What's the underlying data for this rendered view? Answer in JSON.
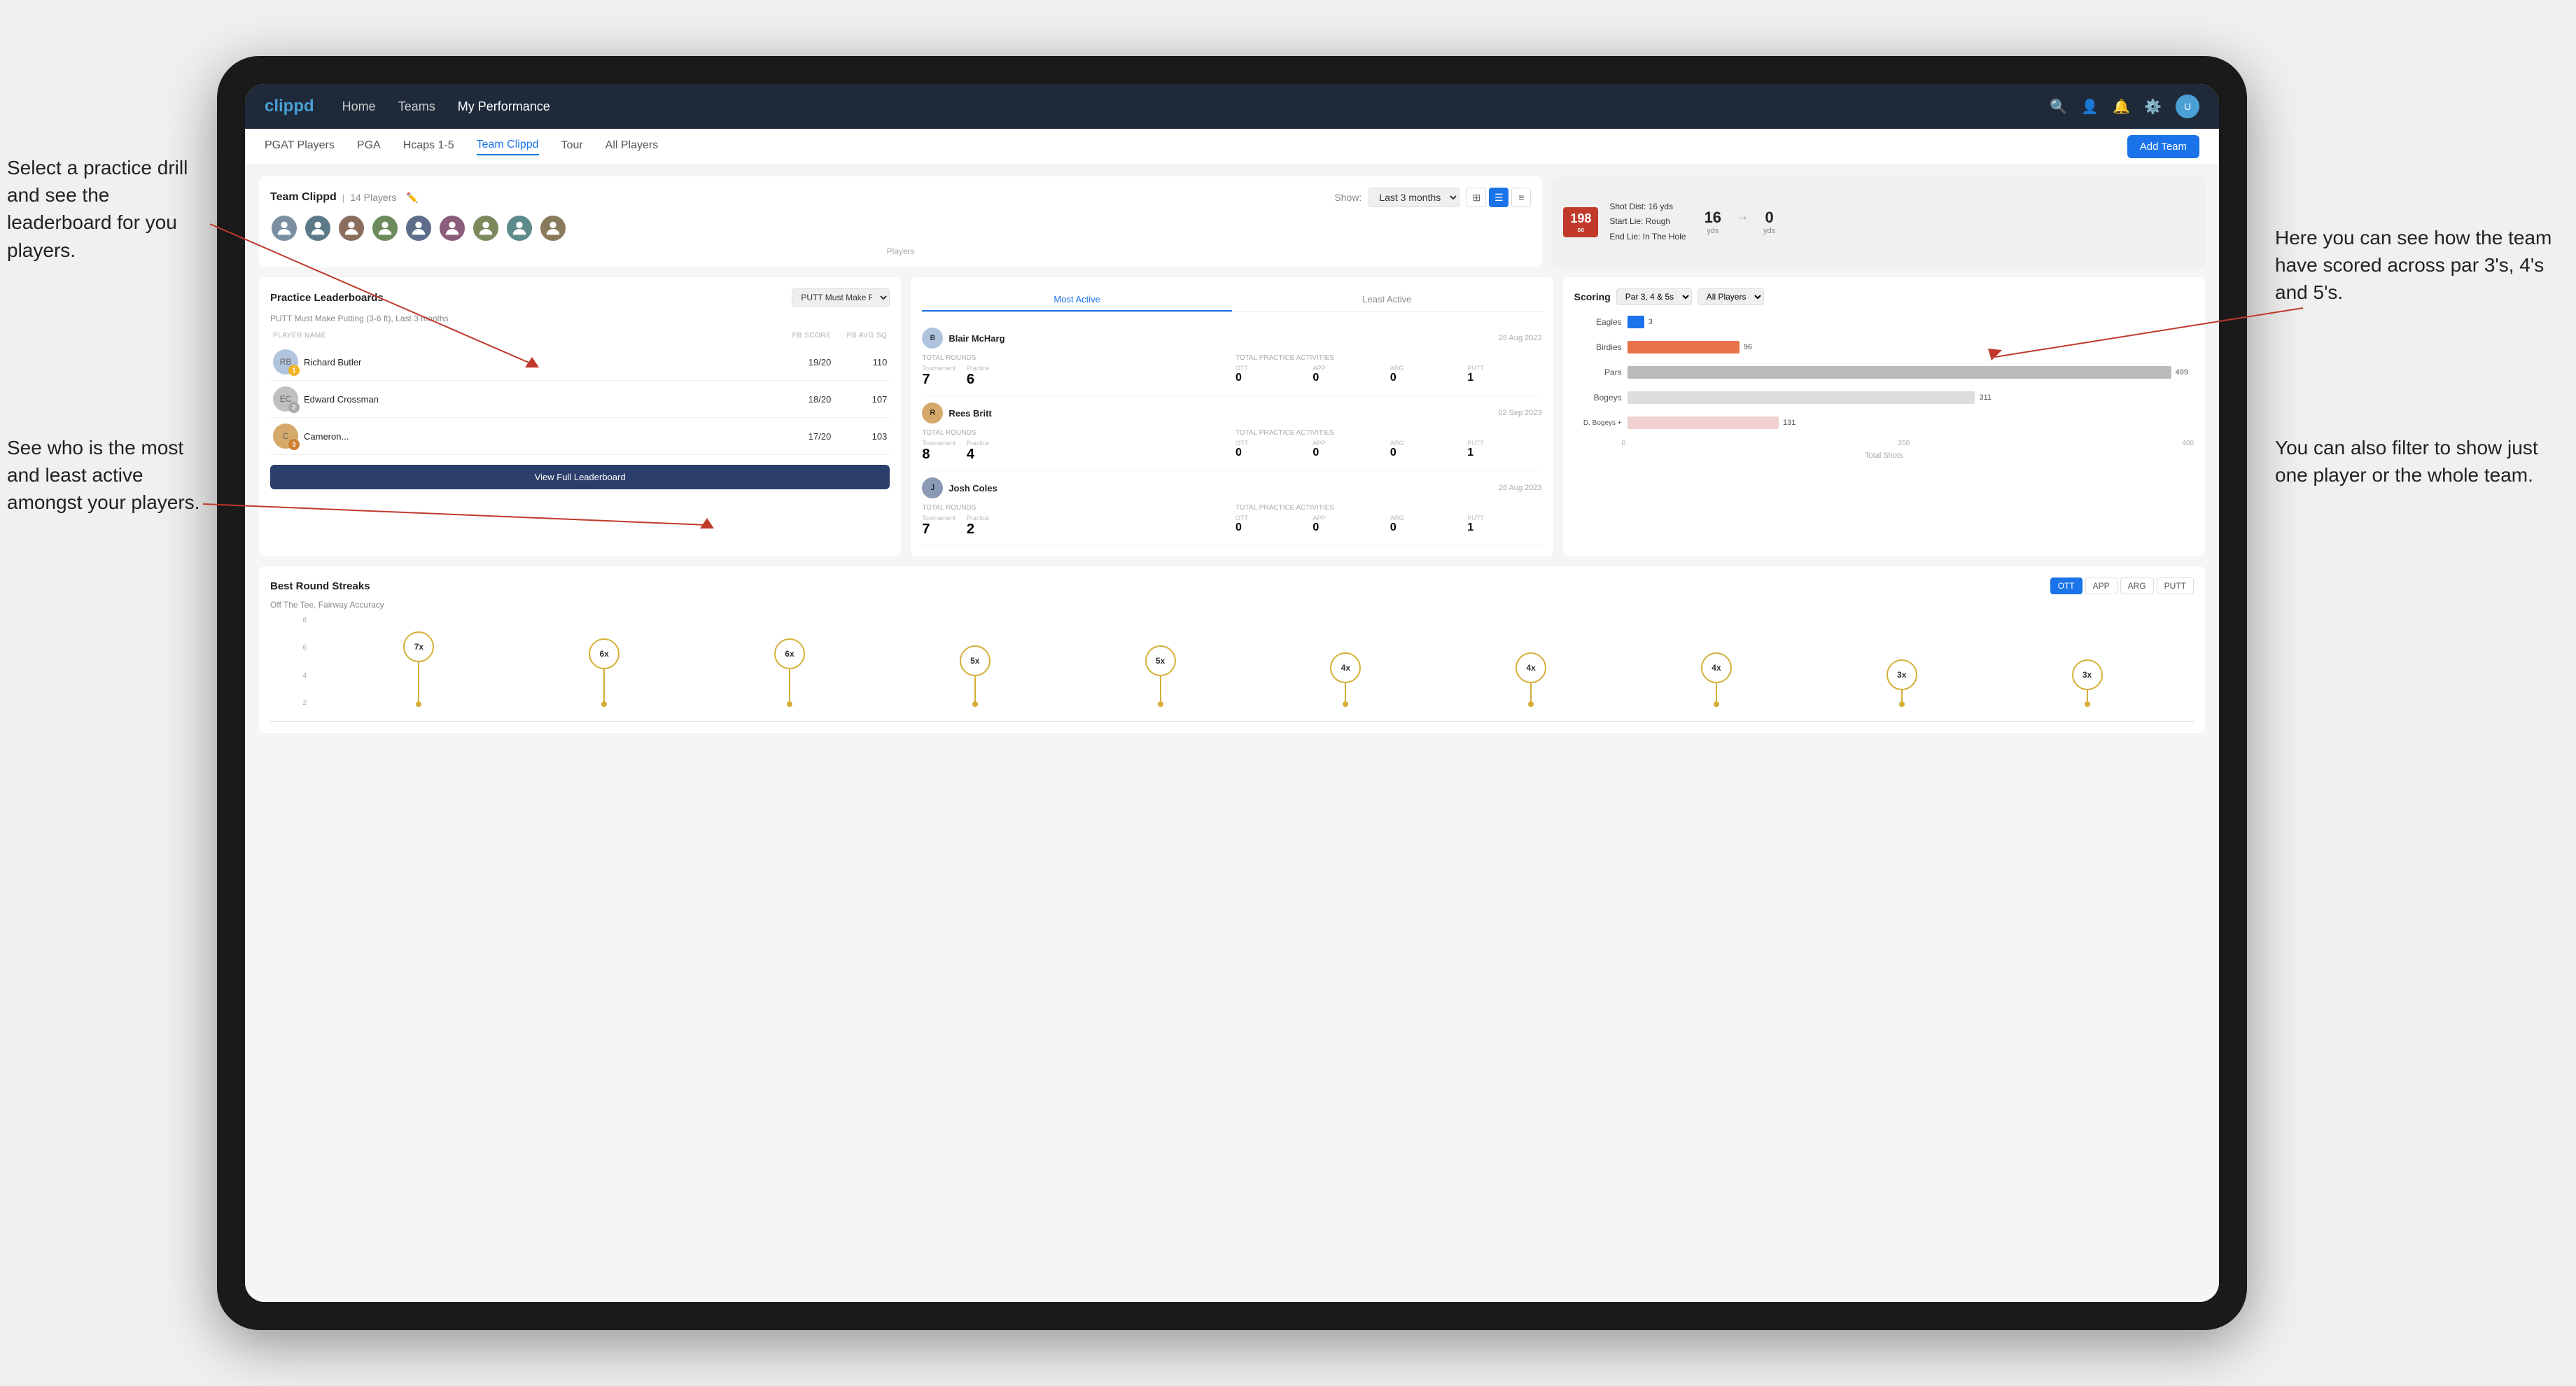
{
  "annotations": {
    "left1": "Select a practice drill and see the leaderboard for you players.",
    "left2": "See who is the most and least active amongst your players.",
    "right1": "Here you can see how the team have scored across par 3's, 4's and 5's.",
    "right2": "You can also filter to show just one player or the whole team."
  },
  "navbar": {
    "brand": "clippd",
    "links": [
      "Home",
      "Teams",
      "My Performance"
    ],
    "icons": [
      "🔍",
      "👤",
      "🔔",
      "⚙️"
    ]
  },
  "sub_navbar": {
    "links": [
      "PGAT Players",
      "PGA",
      "Hcaps 1-5",
      "Team Clippd",
      "Tour",
      "All Players"
    ],
    "active": "Team Clippd",
    "add_team": "Add Team"
  },
  "team_header": {
    "title": "Team Clippd",
    "count": "14 Players",
    "show_label": "Show:",
    "show_option": "Last 3 months",
    "shot_num": "198",
    "shot_dist": "Shot Dist: 16 yds",
    "start_lie": "Start Lie: Rough",
    "end_lie": "End Lie: In The Hole",
    "yards1": "16",
    "yards1_unit": "yds",
    "yards2": "0",
    "yards2_unit": "yds"
  },
  "practice_leaderboards": {
    "title": "Practice Leaderboards",
    "dropdown": "PUTT Must Make Putting...",
    "subtitle": "PUTT Must Make Putting (3-6 ft), Last 3 months",
    "headers": [
      "PLAYER NAME",
      "PB SCORE",
      "PB AVG SQ"
    ],
    "players": [
      {
        "name": "Richard Butler",
        "score": "19/20",
        "avg": "110",
        "medal": "gold",
        "rank": 1
      },
      {
        "name": "Edward Crossman",
        "score": "18/20",
        "avg": "107",
        "medal": "silver",
        "rank": 2
      },
      {
        "name": "Cameron...",
        "score": "17/20",
        "avg": "103",
        "medal": "bronze",
        "rank": 3
      }
    ],
    "view_full": "View Full Leaderboard"
  },
  "activity": {
    "tabs": [
      "Most Active",
      "Least Active"
    ],
    "active_tab": "Most Active",
    "players": [
      {
        "name": "Blair McHarg",
        "date": "26 Aug 2023",
        "total_rounds_label": "Total Rounds",
        "tournament": "7",
        "practice": "6",
        "total_practice_label": "Total Practice Activities",
        "ott": "0",
        "app": "0",
        "arg": "0",
        "putt": "1"
      },
      {
        "name": "Rees Britt",
        "date": "02 Sep 2023",
        "total_rounds_label": "Total Rounds",
        "tournament": "8",
        "practice": "4",
        "total_practice_label": "Total Practice Activities",
        "ott": "0",
        "app": "0",
        "arg": "0",
        "putt": "1"
      },
      {
        "name": "Josh Coles",
        "date": "26 Aug 2023",
        "total_rounds_label": "Total Rounds",
        "tournament": "7",
        "practice": "2",
        "total_practice_label": "Total Practice Activities",
        "ott": "0",
        "app": "0",
        "arg": "0",
        "putt": "1"
      }
    ]
  },
  "scoring": {
    "title": "Scoring",
    "filter1": "Par 3, 4 & 5s",
    "filter2": "All Players",
    "bars": [
      {
        "label": "Eagles",
        "value": 3,
        "max": 500,
        "color": "eagles"
      },
      {
        "label": "Birdies",
        "value": 96,
        "max": 500,
        "color": "birdies"
      },
      {
        "label": "Pars",
        "value": 499,
        "max": 500,
        "color": "pars"
      },
      {
        "label": "Bogeys",
        "value": 311,
        "max": 500,
        "color": "bogeys"
      },
      {
        "label": "D. Bogeys +",
        "value": 131,
        "max": 500,
        "color": "dbogeys"
      }
    ],
    "x_axis": [
      "0",
      "200",
      "400"
    ],
    "total_shots": "Total Shots"
  },
  "streaks": {
    "title": "Best Round Streaks",
    "tabs": [
      "OTT",
      "APP",
      "ARG",
      "PUTT"
    ],
    "active_tab": "OTT",
    "subtitle": "Off The Tee, Fairway Accuracy",
    "items": [
      {
        "label": "7x",
        "height": 100
      },
      {
        "label": "6x",
        "height": 85
      },
      {
        "label": "6x",
        "height": 85
      },
      {
        "label": "5x",
        "height": 70
      },
      {
        "label": "5x",
        "height": 70
      },
      {
        "label": "4x",
        "height": 55
      },
      {
        "label": "4x",
        "height": 55
      },
      {
        "label": "4x",
        "height": 55
      },
      {
        "label": "3x",
        "height": 40
      },
      {
        "label": "3x",
        "height": 40
      }
    ]
  }
}
